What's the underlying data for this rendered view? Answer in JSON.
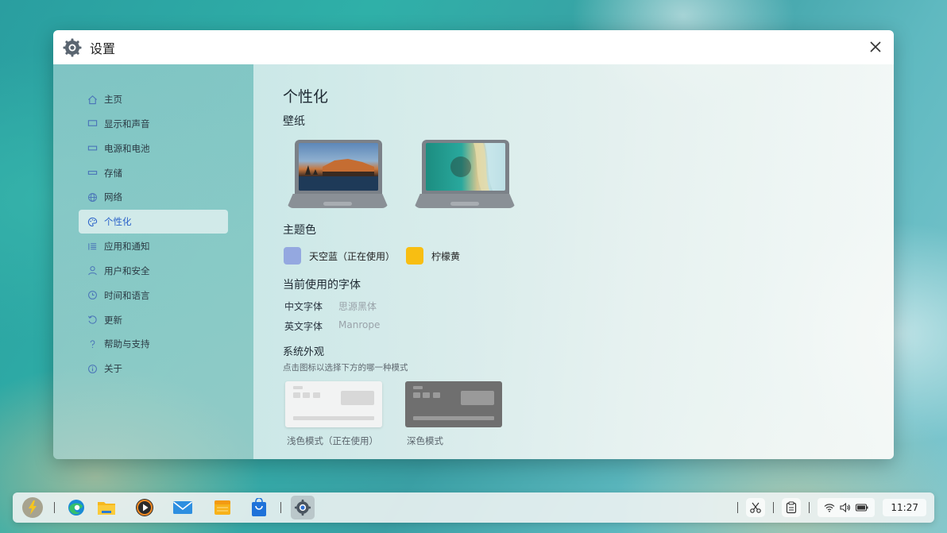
{
  "window": {
    "title": "设置"
  },
  "sidebar": {
    "items": [
      {
        "label": "主页",
        "icon": "home-icon"
      },
      {
        "label": "显示和声音",
        "icon": "monitor-icon"
      },
      {
        "label": "电源和电池",
        "icon": "battery-icon"
      },
      {
        "label": "存储",
        "icon": "storage-icon"
      },
      {
        "label": "网络",
        "icon": "globe-icon"
      },
      {
        "label": "个性化",
        "icon": "palette-icon",
        "active": true
      },
      {
        "label": "应用和通知",
        "icon": "list-icon"
      },
      {
        "label": "用户和安全",
        "icon": "user-icon"
      },
      {
        "label": "时间和语言",
        "icon": "clock-icon"
      },
      {
        "label": "更新",
        "icon": "refresh-icon"
      },
      {
        "label": "帮助与支持",
        "icon": "help-icon"
      },
      {
        "label": "关于",
        "icon": "info-icon"
      }
    ]
  },
  "main": {
    "title": "个性化",
    "wallpaper_heading": "壁纸",
    "theme_heading": "主题色",
    "themes": [
      {
        "label": "天空蓝（正在使用）",
        "color": "#94a8e0"
      },
      {
        "label": "柠檬黄",
        "color": "#f8be12"
      }
    ],
    "font_heading": "当前使用的字体",
    "fonts": [
      {
        "key": "中文字体",
        "value": "思源黑体"
      },
      {
        "key": "英文字体",
        "value": "Manrope"
      }
    ],
    "appearance_heading": "系统外观",
    "appearance_hint": "点击图标以选择下方的哪一种模式",
    "modes": [
      {
        "label": "浅色模式（正在使用）"
      },
      {
        "label": "深色模式"
      }
    ]
  },
  "taskbar": {
    "time": "11:27"
  },
  "colors": {
    "accent": "#2a62c9"
  }
}
